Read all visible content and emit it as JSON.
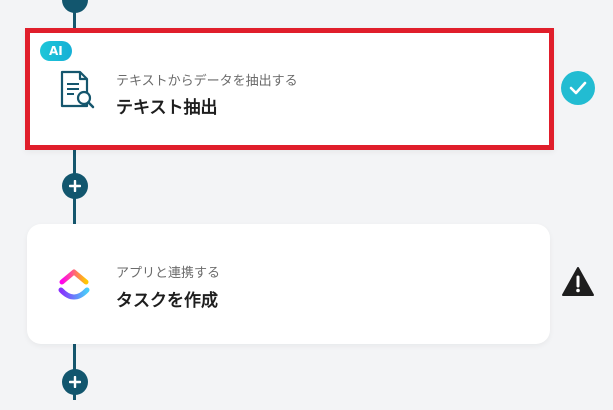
{
  "steps": [
    {
      "badge": "AI",
      "subtitle": "テキストからデータを抽出する",
      "title": "テキスト抽出",
      "icon": "document-search-icon",
      "status": "completed",
      "selected": true
    },
    {
      "subtitle": "アプリと連携する",
      "title": "タスクを作成",
      "icon": "clickup-logo-icon",
      "status": "warning",
      "selected": false
    }
  ],
  "colors": {
    "connector": "#15566d",
    "highlight": "#e01e2b",
    "check": "#22bcd2",
    "warning": "#1e1e1e"
  }
}
